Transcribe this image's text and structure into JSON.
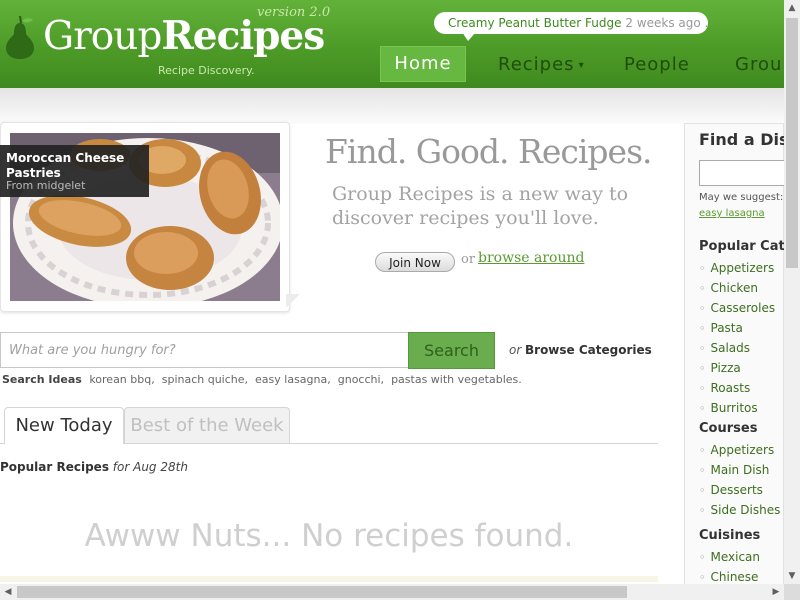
{
  "header": {
    "logo_part1": "Group",
    "logo_part2": "Recipes",
    "version": "version 2.0",
    "tagline": "Recipe Discovery.",
    "bubble": {
      "recipe": "Creamy Peanut Butter Fudge",
      "time": "2 weeks ago ..."
    },
    "nav": [
      {
        "label": "Home"
      },
      {
        "label": "Recipes"
      },
      {
        "label": "People"
      },
      {
        "label": "Grou"
      }
    ]
  },
  "hero": {
    "photo_title": "Moroccan Cheese Pastries",
    "photo_by": "From midgelet",
    "title": "Find. Good. Recipes.",
    "subtitle": "Group Recipes is a new way to discover recipes you'll love.",
    "join_label": "Join Now",
    "or_text": "or",
    "browse_label": "browse around"
  },
  "search": {
    "placeholder": "What are you hungry for?",
    "button_label": "Search",
    "or_text": "or",
    "browse_categories": "Browse Categories",
    "ideas_label": "Search Ideas",
    "ideas": [
      "korean bbq,",
      "spinach quiche,",
      "easy lasagna,",
      "gnocchi,",
      "pastas with vegetables."
    ]
  },
  "tabs": [
    {
      "label": "New Today"
    },
    {
      "label": "Best of the Week"
    }
  ],
  "popular": {
    "label": "Popular Recipes",
    "date": "for Aug 28th"
  },
  "no_results": "Awww Nuts... No recipes found.",
  "sidebar": {
    "find_title": "Find a Dish",
    "suggest_label": "May we suggest:",
    "suggest_link": "easy lasagna",
    "popular_title": "Popular Categ",
    "popular_items": [
      "Appetizers",
      "Chicken",
      "Casseroles",
      "Pasta",
      "Salads",
      "Pizza",
      "Roasts",
      "Burritos"
    ],
    "courses_title": "Courses",
    "courses_items": [
      "Appetizers",
      "Main Dish",
      "Desserts",
      "Side Dishes"
    ],
    "cuisines_title": "Cuisines",
    "cuisines_items": [
      "Mexican",
      "Chinese"
    ]
  },
  "colors": {
    "brand_green": "#4d9b27",
    "link_green": "#5a9a30",
    "search_button": "#6aad4e"
  }
}
